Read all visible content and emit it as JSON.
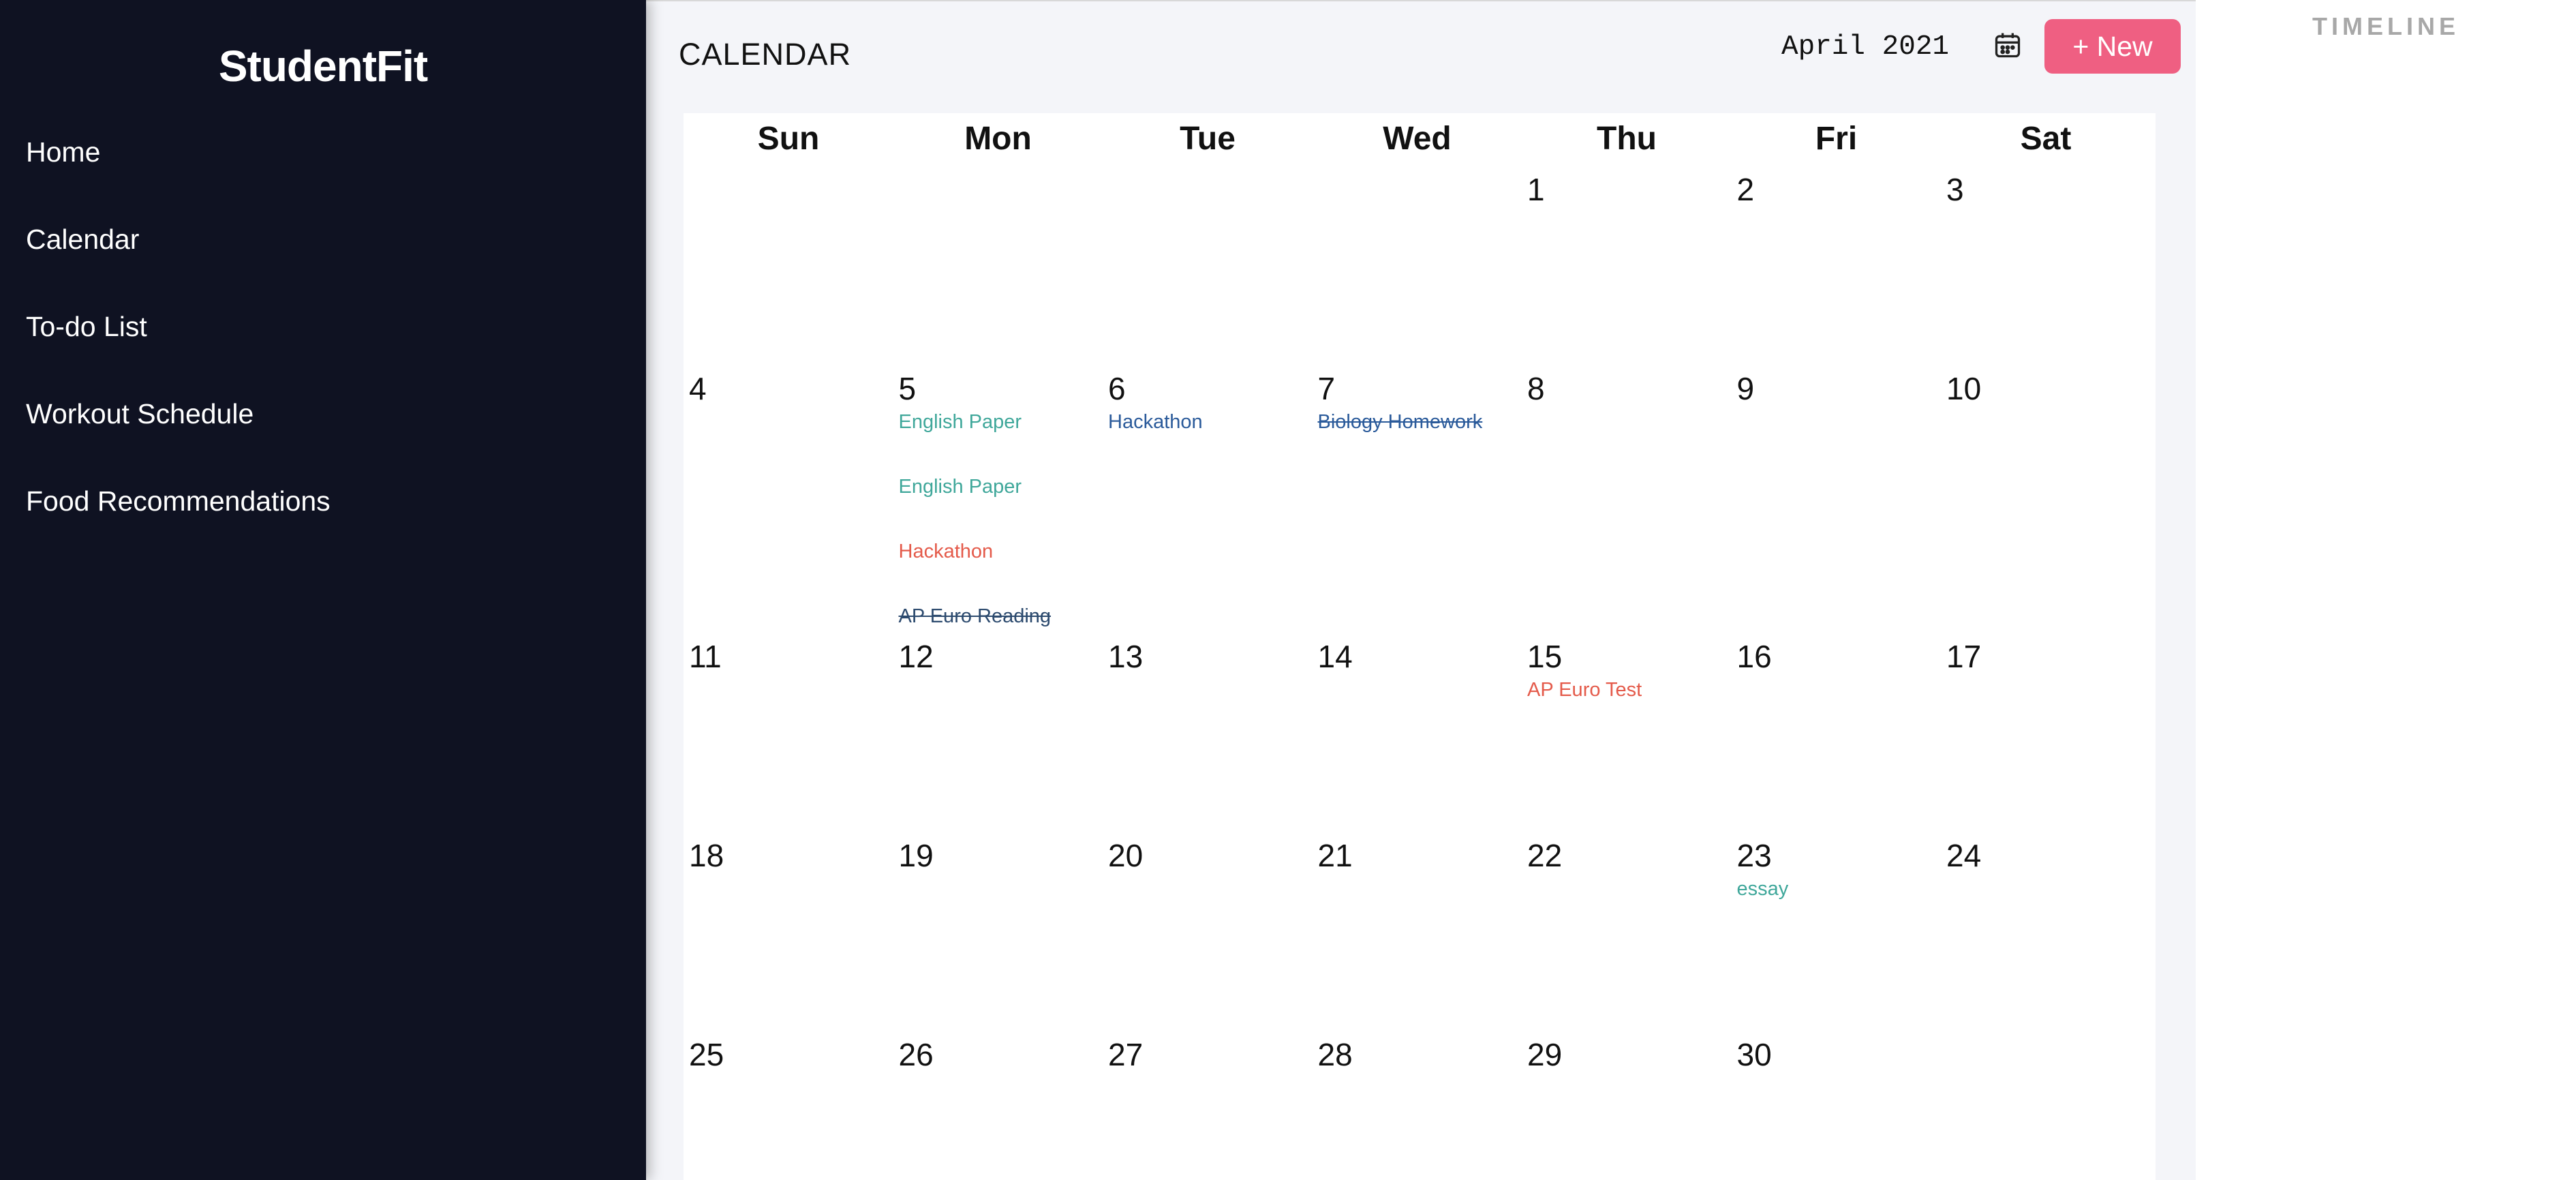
{
  "sidebar": {
    "brand": "StudentFit",
    "items": [
      {
        "label": "Home"
      },
      {
        "label": "Calendar"
      },
      {
        "label": "To-do List"
      },
      {
        "label": "Workout Schedule"
      },
      {
        "label": "Food Recommendations"
      }
    ]
  },
  "header": {
    "title": "CALENDAR",
    "month": "April 2021",
    "calendar_icon": "calendar-icon",
    "new_button": "+ New"
  },
  "calendar": {
    "weekdays": [
      "Sun",
      "Mon",
      "Tue",
      "Wed",
      "Thu",
      "Fri",
      "Sat"
    ],
    "weeks": [
      [
        {
          "day": "",
          "events": []
        },
        {
          "day": "",
          "events": []
        },
        {
          "day": "",
          "events": []
        },
        {
          "day": "",
          "events": []
        },
        {
          "day": "1",
          "events": []
        },
        {
          "day": "2",
          "events": []
        },
        {
          "day": "3",
          "events": []
        }
      ],
      [
        {
          "day": "4",
          "events": []
        },
        {
          "day": "5",
          "events": [
            {
              "title": "English Paper",
              "color": "#3fa79a",
              "done": false
            },
            {
              "title": "English Paper",
              "color": "#3fa79a",
              "done": false
            },
            {
              "title": "Hackathon",
              "color": "#e45a4a",
              "done": false
            },
            {
              "title": "AP Euro Reading",
              "color": "#2c4a6e",
              "done": true
            }
          ]
        },
        {
          "day": "6",
          "events": [
            {
              "title": "Hackathon",
              "color": "#2a5a9a",
              "done": false
            }
          ]
        },
        {
          "day": "7",
          "events": [
            {
              "title": "Biology Homework",
              "color": "#2a5a9a",
              "done": true
            }
          ]
        },
        {
          "day": "8",
          "events": []
        },
        {
          "day": "9",
          "events": []
        },
        {
          "day": "10",
          "events": []
        }
      ],
      [
        {
          "day": "11",
          "events": []
        },
        {
          "day": "12",
          "events": []
        },
        {
          "day": "13",
          "events": []
        },
        {
          "day": "14",
          "events": []
        },
        {
          "day": "15",
          "events": [
            {
              "title": "AP Euro Test",
              "color": "#e45a4a",
              "done": false
            }
          ]
        },
        {
          "day": "16",
          "events": []
        },
        {
          "day": "17",
          "events": []
        }
      ],
      [
        {
          "day": "18",
          "events": []
        },
        {
          "day": "19",
          "events": []
        },
        {
          "day": "20",
          "events": []
        },
        {
          "day": "21",
          "events": []
        },
        {
          "day": "22",
          "events": []
        },
        {
          "day": "23",
          "events": [
            {
              "title": "essay",
              "color": "#3fa79a",
              "done": false
            }
          ]
        },
        {
          "day": "24",
          "events": []
        }
      ],
      [
        {
          "day": "25",
          "events": []
        },
        {
          "day": "26",
          "events": []
        },
        {
          "day": "27",
          "events": []
        },
        {
          "day": "28",
          "events": []
        },
        {
          "day": "29",
          "events": []
        },
        {
          "day": "30",
          "events": []
        },
        {
          "day": "",
          "events": []
        }
      ]
    ]
  },
  "timeline": {
    "title": "TIMELINE"
  },
  "colors": {
    "sidebar_bg": "#0f1222",
    "accent": "#ef5f82",
    "main_bg": "#f4f5f9"
  }
}
